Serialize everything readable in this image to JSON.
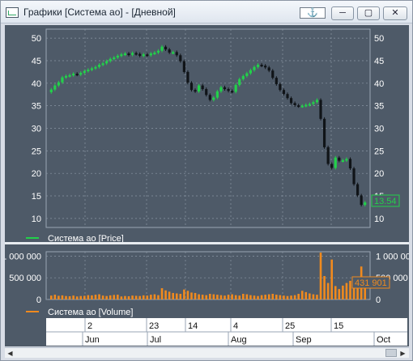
{
  "window": {
    "title": "Графики [Система ао] - [Дневной]",
    "anchor_button": "⚓",
    "minimize_button": "─",
    "maximize_button": "▢",
    "close_button": "✕"
  },
  "colors": {
    "background": "#4e5a68",
    "up_candle": "#22d14a",
    "down_candle": "#101418",
    "volume": "#f08a1e",
    "grid": "#8a96a4",
    "axis_text": "#ffffff"
  },
  "price_panel": {
    "legend": "Система ао [Price]",
    "last_value_label": "13.54"
  },
  "volume_panel": {
    "legend": "Система ао [Volume]",
    "last_value_label": "431 901"
  },
  "date_axis": {
    "day_labels": [
      "2",
      "23",
      "14",
      "4",
      "25",
      "15"
    ],
    "month_labels": [
      "Jun",
      "Jul",
      "Aug",
      "Sep",
      "Oct"
    ]
  },
  "chart_data": [
    {
      "type": "candlestick",
      "series": [
        {
          "name": "Система ао [Price]"
        }
      ],
      "ylim": [
        8,
        52
      ],
      "y_ticks": [
        10,
        15,
        20,
        25,
        30,
        35,
        40,
        45,
        50
      ],
      "close_values": [
        38.6,
        39.5,
        40.2,
        41.3,
        41.6,
        41.8,
        42.1,
        41.9,
        42.3,
        42.7,
        43.0,
        43.3,
        43.6,
        44.1,
        44.4,
        44.9,
        45.4,
        45.7,
        46.1,
        46.4,
        46.6,
        46.3,
        46.7,
        46.5,
        46.1,
        46.4,
        46.2,
        46.6,
        46.8,
        47.2,
        48.1,
        47.5,
        46.8,
        46.9,
        46.2,
        44.9,
        42.5,
        40.1,
        38.5,
        38.2,
        39.5,
        38.7,
        37.4,
        36.3,
        36.8,
        38.2,
        39.1,
        38.7,
        38.3,
        38.1,
        39.6,
        40.9,
        41.6,
        42.2,
        42.9,
        43.6,
        44.1,
        43.9,
        43.5,
        42.8,
        41.2,
        39.8,
        38.5,
        37.6,
        36.7,
        35.6,
        35.1,
        34.9,
        35.0,
        35.2,
        35.4,
        35.8,
        36.3,
        32.1,
        25.8,
        22.1,
        21.2,
        23.5,
        22.8,
        22.9,
        23.2,
        21.1,
        17.6,
        15.1,
        13.0,
        13.54
      ]
    },
    {
      "type": "bar",
      "series": [
        {
          "name": "Система ао [Volume]"
        }
      ],
      "ylim": [
        0,
        1100000
      ],
      "y_ticks": [
        0,
        500000,
        1000000
      ],
      "values": [
        90000,
        110000,
        85000,
        95000,
        80000,
        75000,
        90000,
        70000,
        80000,
        85000,
        100000,
        95000,
        110000,
        120000,
        90000,
        80000,
        95000,
        105000,
        110000,
        70000,
        80000,
        75000,
        90000,
        85000,
        80000,
        95000,
        90000,
        110000,
        120000,
        100000,
        260000,
        210000,
        180000,
        150000,
        140000,
        130000,
        230000,
        200000,
        160000,
        150000,
        120000,
        110000,
        100000,
        130000,
        120000,
        110000,
        100000,
        90000,
        110000,
        120000,
        100000,
        90000,
        130000,
        120000,
        100000,
        90000,
        80000,
        100000,
        110000,
        120000,
        130000,
        110000,
        100000,
        90000,
        80000,
        90000,
        100000,
        130000,
        200000,
        170000,
        140000,
        120000,
        110000,
        1080000,
        540000,
        380000,
        920000,
        310000,
        240000,
        320000,
        380000,
        430000,
        480000,
        360000,
        760000,
        431901
      ]
    }
  ]
}
